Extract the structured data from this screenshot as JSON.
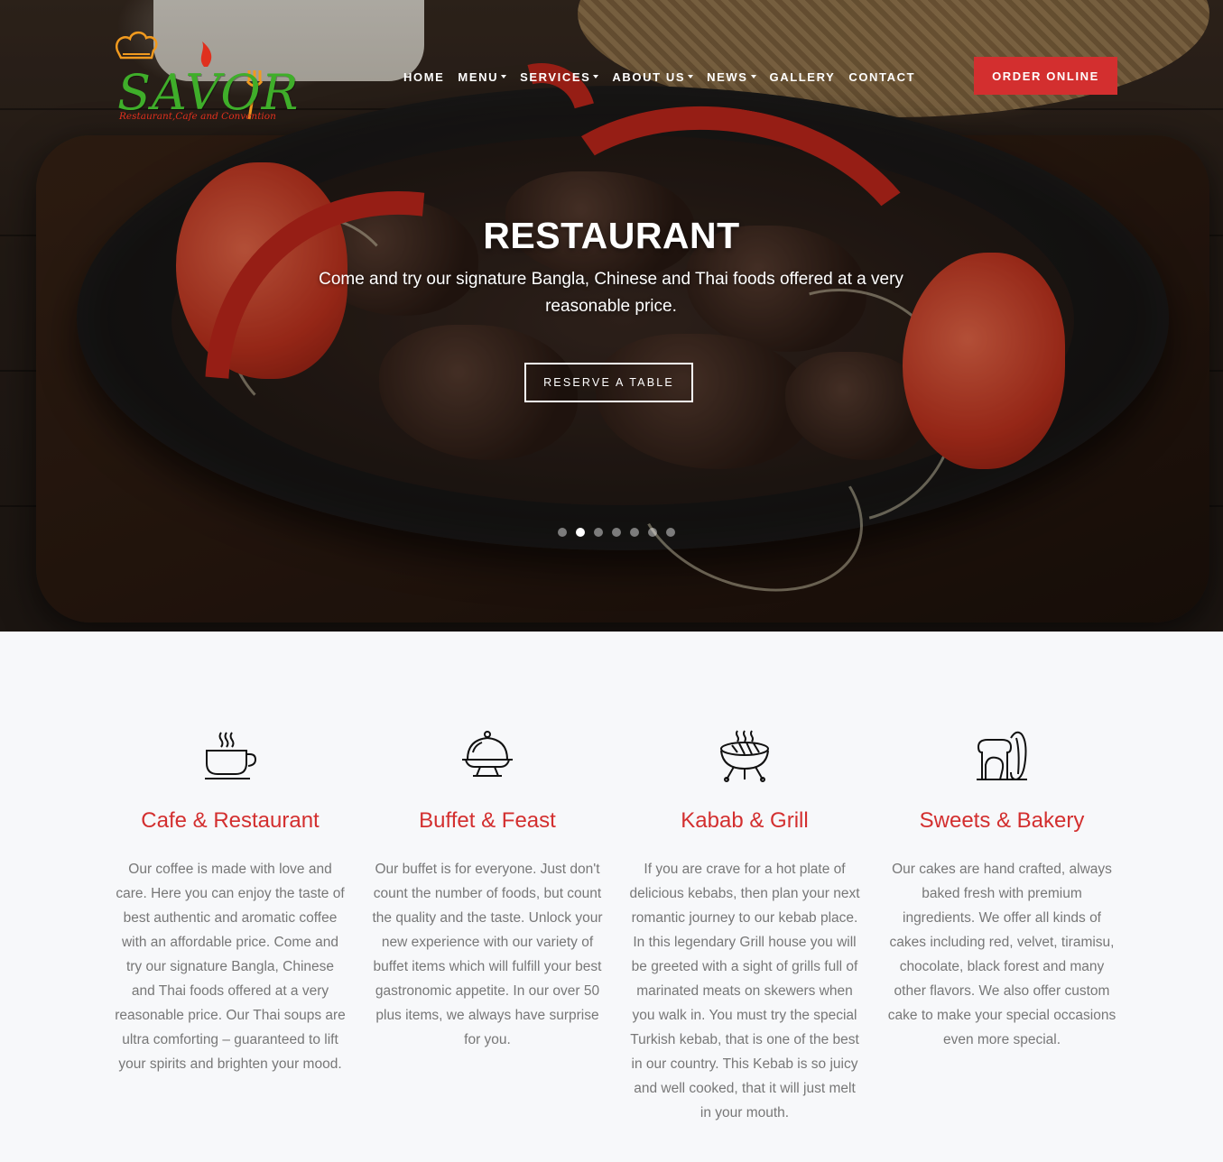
{
  "brand": {
    "name": "SAVOR",
    "tagline": "Restaurant,Cafe and Convention"
  },
  "nav": {
    "items": [
      {
        "label": "HOME",
        "has_dropdown": false
      },
      {
        "label": "MENU",
        "has_dropdown": true
      },
      {
        "label": "SERVICES",
        "has_dropdown": true
      },
      {
        "label": "ABOUT US",
        "has_dropdown": true
      },
      {
        "label": "NEWS",
        "has_dropdown": true
      },
      {
        "label": "GALLERY",
        "has_dropdown": false
      },
      {
        "label": "CONTACT",
        "has_dropdown": false
      }
    ],
    "order_button": "ORDER ONLINE"
  },
  "hero": {
    "title": "RESTAURANT",
    "subtitle": "Come and try our signature Bangla, Chinese and Thai foods offered at a very reasonable price.",
    "cta": "RESERVE A TABLE",
    "slide_count": 7,
    "active_slide": 2
  },
  "features": [
    {
      "icon": "coffee-cup-icon",
      "title": "Cafe & Restaurant",
      "text": "Our coffee is made with love and care. Here you can enjoy the taste of best authentic and aromatic coffee with an affordable price. Come and try our signature Bangla, Chinese and Thai foods offered at a very reasonable price. Our Thai soups are ultra comforting – guaranteed to lift your spirits and brighten your mood."
    },
    {
      "icon": "serving-cloche-icon",
      "title": "Buffet & Feast",
      "text": "Our buffet is for everyone. Just don't count the number of foods, but count the quality and the taste. Unlock your new experience with our variety of buffet items which will fulfill your best gastronomic appetite. In our over 50 plus items, we always have surprise for you."
    },
    {
      "icon": "grill-icon",
      "title": "Kabab & Grill",
      "text": "If you are crave for a hot plate of delicious kebabs, then plan your next romantic journey to our kebab place. In this legendary Grill house you will be greeted with a sight of grills full of marinated meats on skewers when you walk in. You must try the special Turkish kebab, that is one of the best in our country. This Kebab is so juicy and well cooked, that it will just melt in your mouth."
    },
    {
      "icon": "bread-bakery-icon",
      "title": "Sweets & Bakery",
      "text": "Our cakes are hand crafted, always baked fresh with premium ingredients. We offer all kinds of cakes including red, velvet, tiramisu, chocolate, black forest and many other flavors. We also offer custom cake to make your special occasions even more special."
    }
  ],
  "colors": {
    "accent": "#d32f2f",
    "logo_green": "#3fae2a",
    "logo_orange": "#f19a1f",
    "body_text": "#777777",
    "section_bg": "#f7f8fa"
  }
}
